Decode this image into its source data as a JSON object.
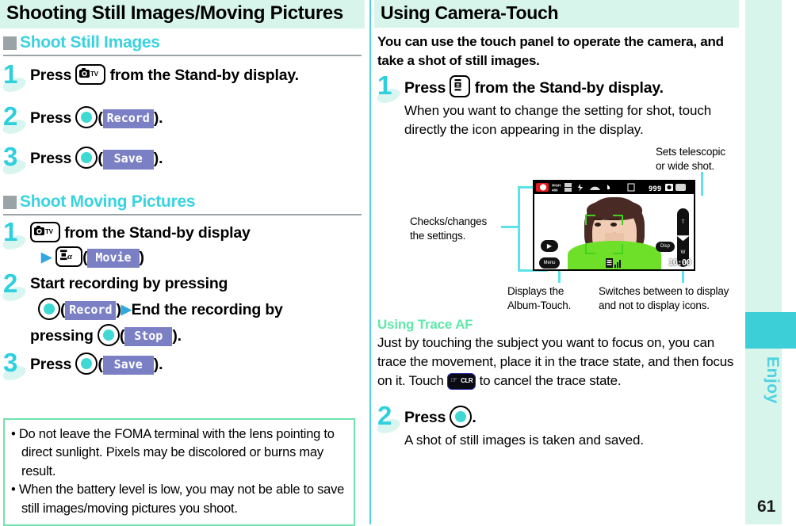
{
  "left": {
    "title": "Shooting Still Images/Moving Pictures",
    "sections": [
      {
        "heading": "Shoot Still Images",
        "steps": [
          {
            "num": "1",
            "pre": "Press",
            "key": "camera-tv-key",
            "post": "from the Stand-by display."
          },
          {
            "num": "2",
            "pre": "Press",
            "key": "center-key",
            "label": "Record",
            "post": ")."
          },
          {
            "num": "3",
            "pre": "Press",
            "key": "center-key",
            "label": "Save",
            "post": ")."
          }
        ]
      },
      {
        "heading": "Shoot Moving Pictures",
        "steps": [
          {
            "num": "1",
            "line1_post": "from the Stand-by display",
            "label": "Movie"
          },
          {
            "num": "2",
            "line1": "Start recording by pressing",
            "label1": "Record",
            "mid": "End the recording by",
            "line3": "pressing",
            "label2": "Stop"
          },
          {
            "num": "3",
            "pre": "Press",
            "label": "Save"
          }
        ]
      }
    ],
    "note": {
      "items": [
        "Do not leave the FOMA terminal with the lens pointing to direct sunlight. Pixels may be discolored or burns may result.",
        "When the battery level is low, you may not be able to save still images/moving pictures you shoot."
      ],
      "bullet": "•"
    }
  },
  "right": {
    "title": "Using Camera-Touch",
    "lead": "You can use the touch panel to operate the camera, and take a shot of still images.",
    "step1": {
      "num": "1",
      "pre": "Press",
      "key": "i-mode-key",
      "post": "from the Stand-by display.",
      "body": "When you want to change the setting for shot, touch directly the icon appearing in the display."
    },
    "figure": {
      "callout_topright": "Sets telescopic\nor wide shot.",
      "callout_left": "Checks/changes\nthe settings.",
      "callout_bottomleft": "Displays the\nAlbum-Touch.",
      "callout_bottomright": "Switches between to display\nand not to display icons.",
      "screen": {
        "shots_remaining": "999",
        "timecode": "10:00",
        "zoom_tele": "T",
        "zoom_wide": "W",
        "btn_menu": "Menu",
        "btn_disp": "Disp",
        "btn_album": "▶"
      }
    },
    "trace": {
      "heading": "Using Trace AF",
      "body_a": "Just by touching the subject you want to focus on, you can trace the movement, place it in the trace state, and then focus on it. Touch",
      "clr_label": "CLR",
      "body_b": "to cancel the trace state."
    },
    "step2": {
      "num": "2",
      "pre": "Press",
      "key": "center-key",
      "post": ".",
      "body": "A shot of still images is taken and saved."
    }
  },
  "sidetab": {
    "label": "Enjoy",
    "page_number": "61"
  },
  "colors": {
    "accent_cyan": "#4fd3e0",
    "title_bg": "#d8f5ec",
    "label_bg": "#7b7fc4",
    "note_border": "#72e3b0",
    "trace_heading": "#5fe8a8",
    "tab_highlight": "#3ccfd7"
  }
}
